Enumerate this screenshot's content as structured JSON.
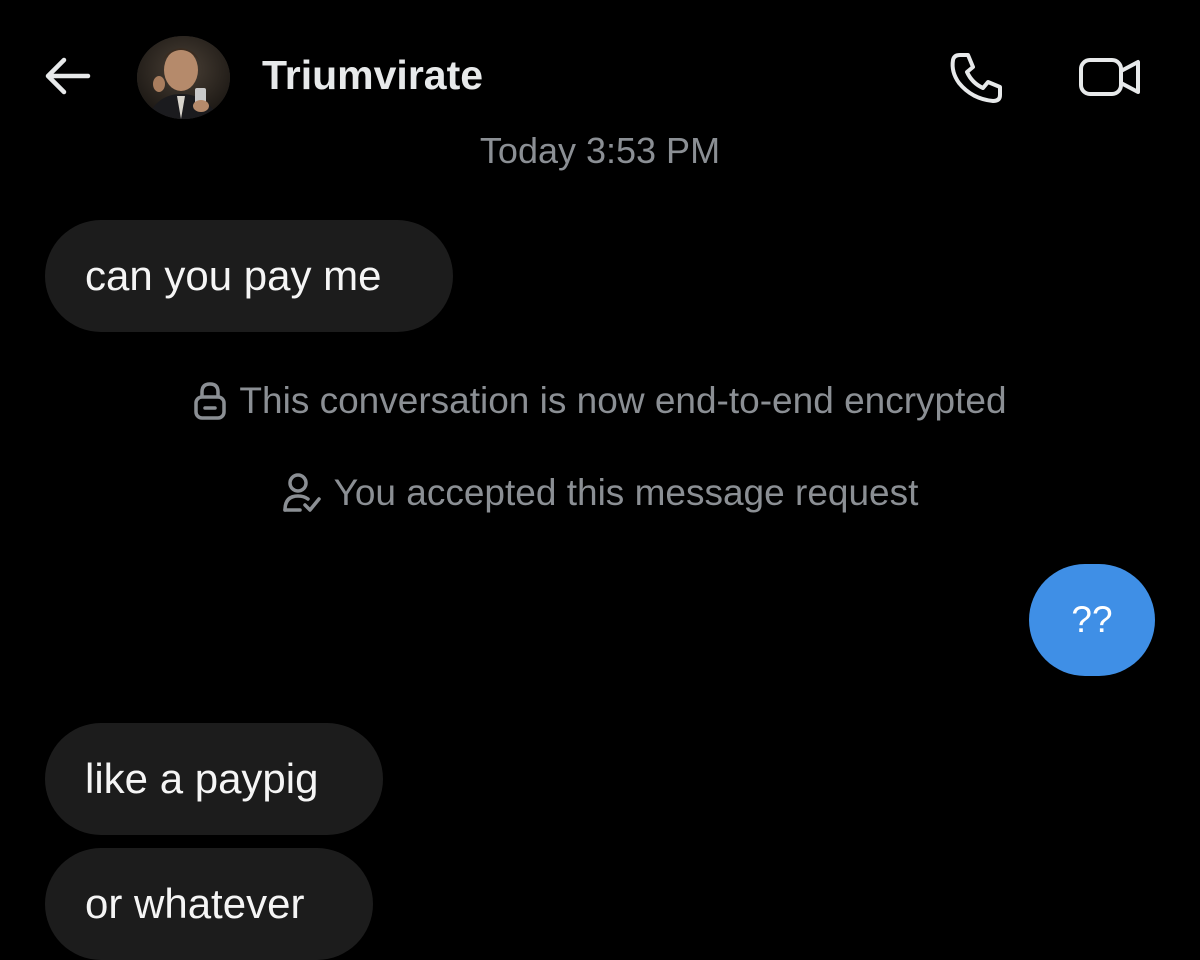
{
  "header": {
    "back_icon": "arrow-left-icon",
    "name": "Triumvirate",
    "call_icon": "phone-icon",
    "video_icon": "video-camera-icon"
  },
  "conversation": {
    "timestamp": "Today 3:53 PM",
    "system_notices": [
      {
        "icon": "lock-icon",
        "text": "This conversation is now end-to-end encrypted"
      },
      {
        "icon": "person-check-icon",
        "text": "You accepted this message request"
      }
    ],
    "messages": [
      {
        "from": "other",
        "text": "can you pay me"
      },
      {
        "from": "me",
        "text": "??"
      },
      {
        "from": "other",
        "text": "like a paypig"
      },
      {
        "from": "other",
        "text": "or whatever"
      }
    ]
  },
  "colors": {
    "background": "#000000",
    "incoming_bubble": "#1c1c1c",
    "outgoing_bubble": "#3f8fe6",
    "muted_text": "#8b8f94"
  }
}
